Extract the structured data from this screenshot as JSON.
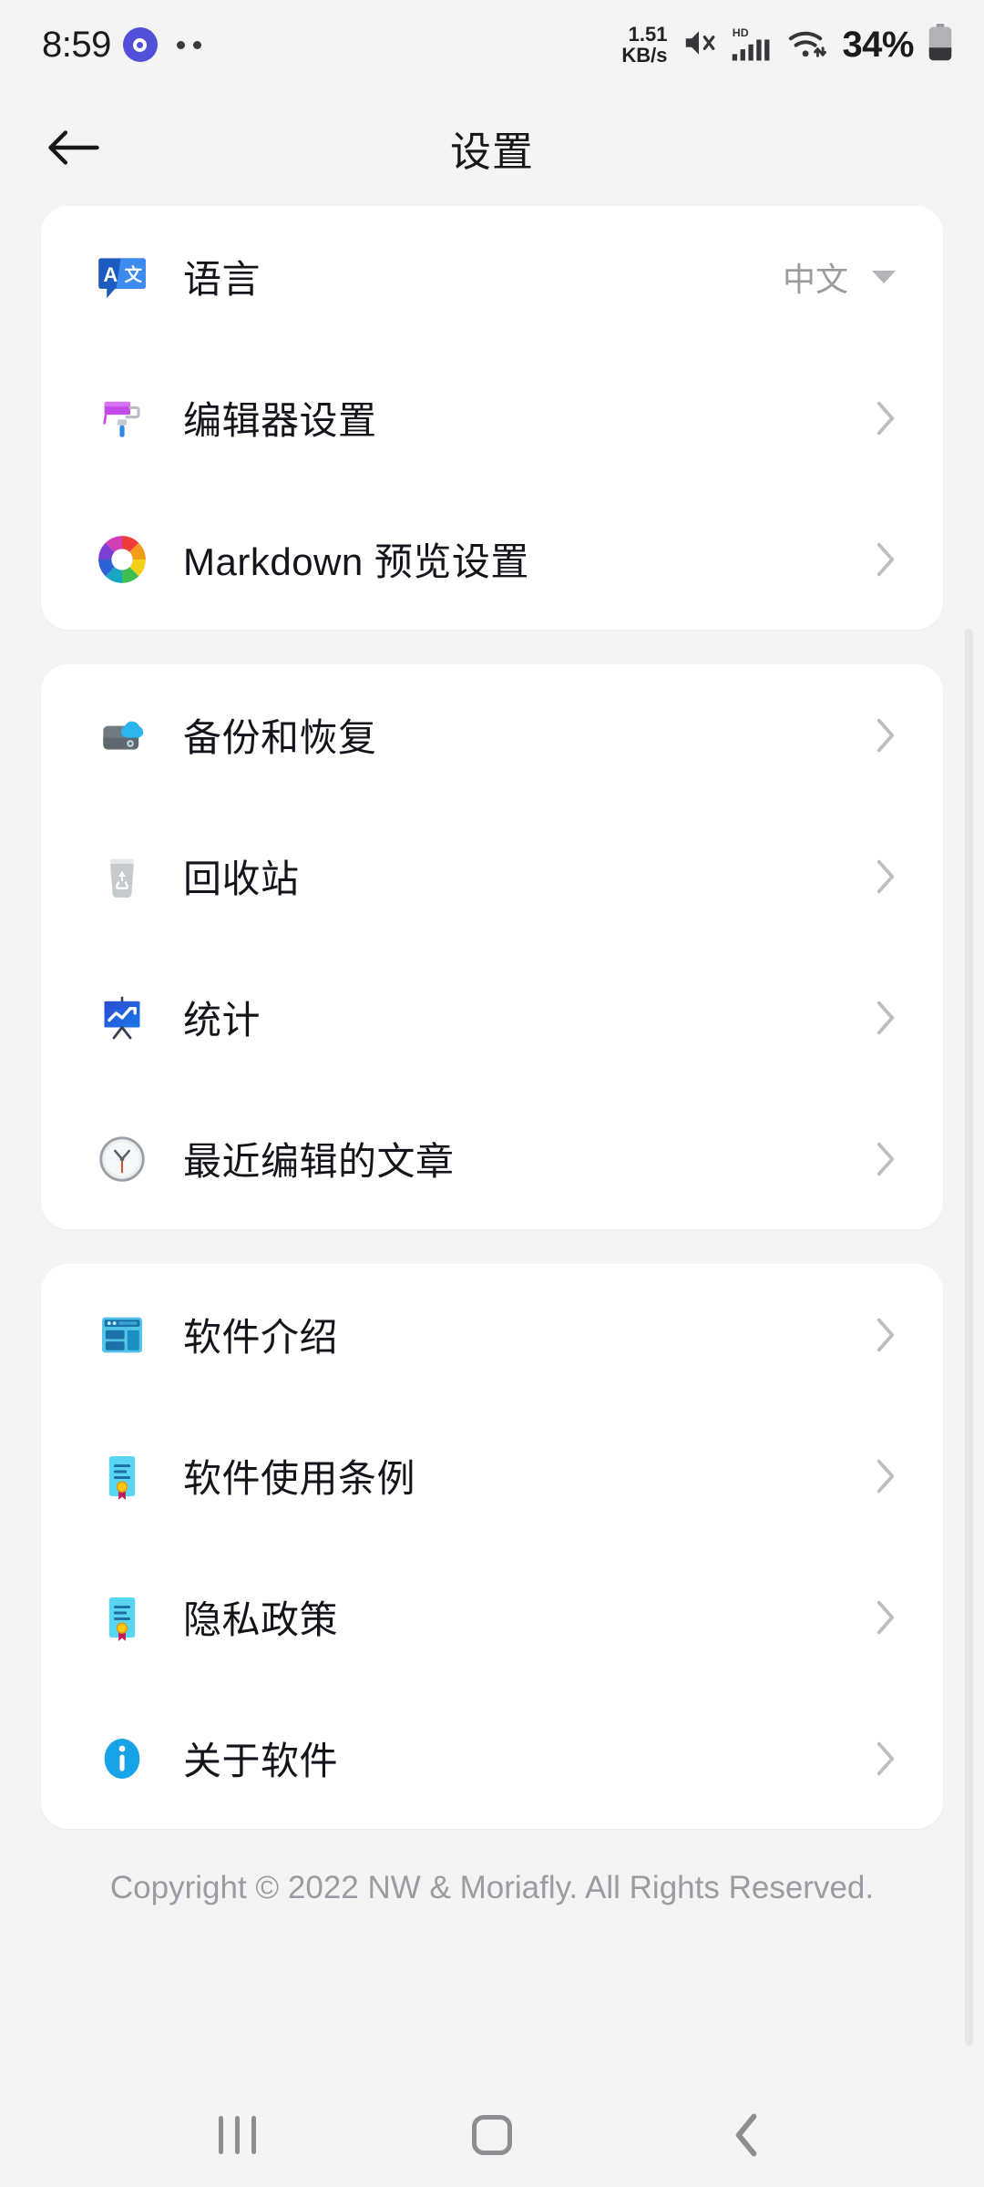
{
  "status_bar": {
    "time": "8:59",
    "app_icon": "record-dot-icon",
    "more_dots": "..",
    "network_speed_value": "1.51",
    "network_speed_unit": "KB/s",
    "mute_icon": "volume-muted-icon",
    "hd_label": "HD",
    "signal_icon": "cellular-signal-icon",
    "wifi_icon": "wifi-icon",
    "battery_percent": "34%",
    "battery_icon": "battery-icon"
  },
  "app_bar": {
    "back_icon": "arrow-left-icon",
    "title": "设置"
  },
  "sections": [
    {
      "rows": [
        {
          "icon": "translate-icon",
          "label": "语言",
          "value": "中文",
          "trailing": "dropdown"
        },
        {
          "icon": "paint-roller-icon",
          "label": "编辑器设置",
          "value": "",
          "trailing": "chevron"
        },
        {
          "icon": "color-wheel-icon",
          "label": "Markdown 预览设置",
          "value": "",
          "trailing": "chevron"
        }
      ]
    },
    {
      "rows": [
        {
          "icon": "cloud-backup-icon",
          "label": "备份和恢复",
          "value": "",
          "trailing": "chevron"
        },
        {
          "icon": "recycle-bin-icon",
          "label": "回收站",
          "value": "",
          "trailing": "chevron"
        },
        {
          "icon": "statistics-icon",
          "label": "统计",
          "value": "",
          "trailing": "chevron"
        },
        {
          "icon": "clock-icon",
          "label": "最近编辑的文章",
          "value": "",
          "trailing": "chevron"
        }
      ]
    },
    {
      "rows": [
        {
          "icon": "window-layout-icon",
          "label": "软件介绍",
          "value": "",
          "trailing": "chevron"
        },
        {
          "icon": "certificate-icon",
          "label": "软件使用条例",
          "value": "",
          "trailing": "chevron"
        },
        {
          "icon": "certificate-icon",
          "label": "隐私政策",
          "value": "",
          "trailing": "chevron"
        },
        {
          "icon": "info-circle-icon",
          "label": "关于软件",
          "value": "",
          "trailing": "chevron"
        }
      ]
    }
  ],
  "footer": {
    "copyright": "Copyright © 2022 NW & Moriafly. All Rights Reserved."
  },
  "nav_bar": {
    "recents_icon": "recents-icon",
    "home_icon": "home-icon",
    "back_icon": "nav-back-icon"
  },
  "colors": {
    "page_background": "#f4f4f4",
    "card_background": "#ffffff",
    "primary_text": "#14141a",
    "secondary_text": "#9a9a9f",
    "footer_text": "#9b9ba1",
    "chevron": "#bdbdc2",
    "accent_blue": "#1565d8",
    "nav_icon": "#8d8d92"
  }
}
